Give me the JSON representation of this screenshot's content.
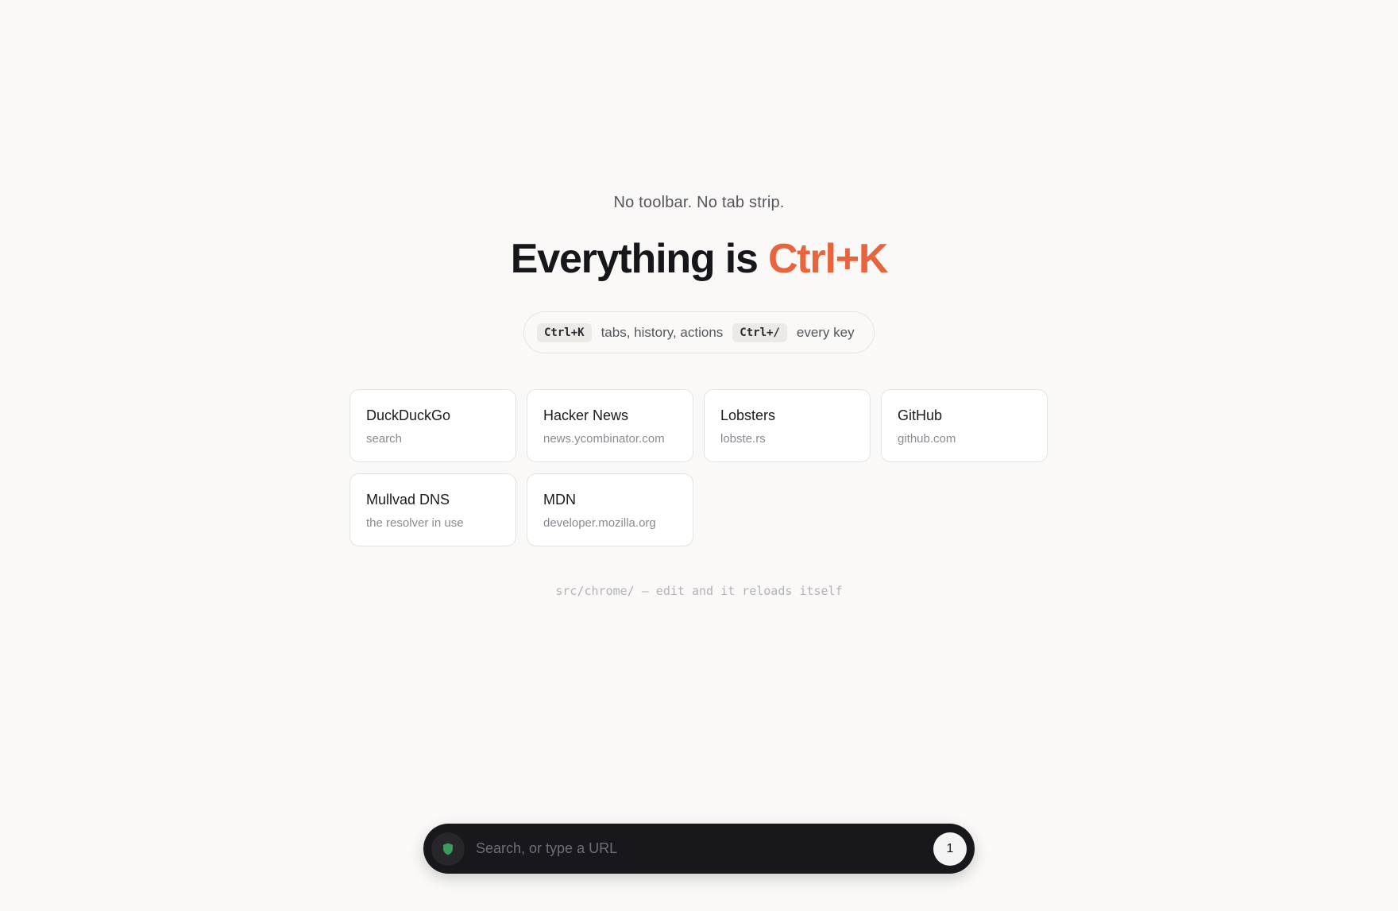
{
  "hero": {
    "tagline": "No toolbar. No tab strip.",
    "headline_prefix": "Everything is ",
    "headline_accent": "Ctrl+K"
  },
  "hints": {
    "items": [
      {
        "key": "Ctrl+K",
        "label": "tabs, history, actions"
      },
      {
        "key": "Ctrl+/",
        "label": "every key"
      }
    ]
  },
  "shortcuts": [
    {
      "title": "DuckDuckGo",
      "subtitle": "search"
    },
    {
      "title": "Hacker News",
      "subtitle": "news.ycombinator.com"
    },
    {
      "title": "Lobsters",
      "subtitle": "lobste.rs"
    },
    {
      "title": "GitHub",
      "subtitle": "github.com"
    },
    {
      "title": "Mullvad DNS",
      "subtitle": "the resolver in use"
    },
    {
      "title": "MDN",
      "subtitle": "developer.mozilla.org"
    }
  ],
  "footnote": "src/chrome/ — edit and it reloads itself",
  "omnibar": {
    "placeholder": "Search, or type a URL",
    "value": "",
    "tab_count": "1",
    "shield_icon": "shield-icon"
  },
  "colors": {
    "accent": "#e8643c",
    "background": "#faf9f7",
    "omnibar": "#18181c",
    "shield": "#3a9b5c"
  }
}
